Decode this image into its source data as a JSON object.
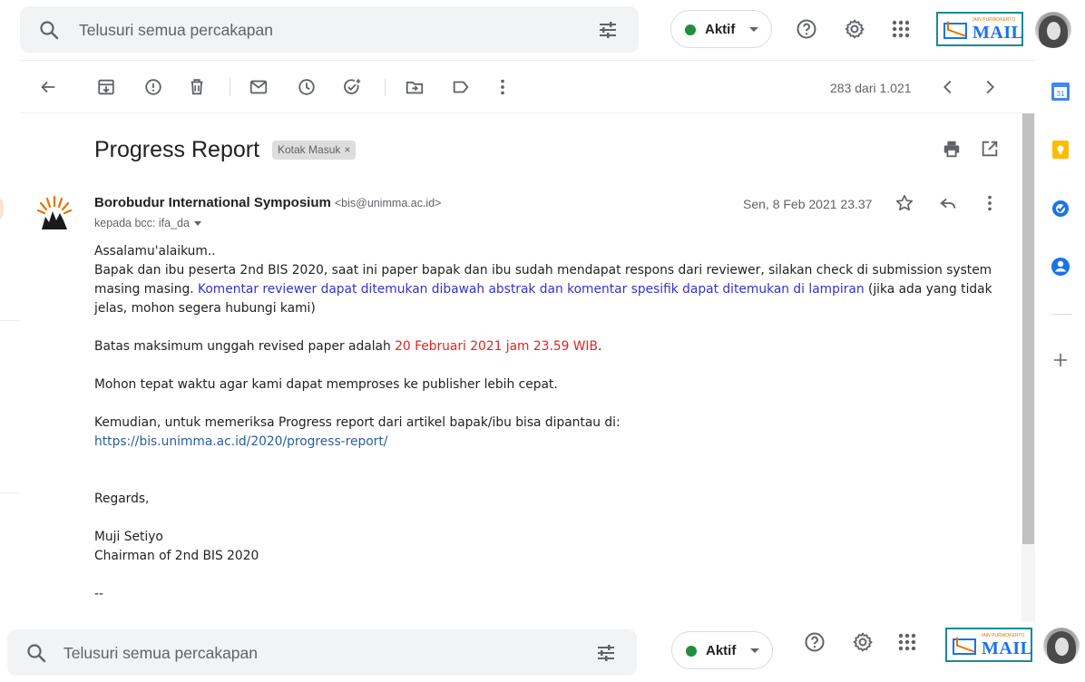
{
  "search": {
    "placeholder": "Telusuri semua percakapan"
  },
  "status": {
    "label": "Aktif",
    "color": "#1e8e3e"
  },
  "brand": {
    "name": "MAIL",
    "tagline": "IAIN PURWOKERTO"
  },
  "icons": {
    "search": "search-icon",
    "tune": "tune-icon",
    "help": "help-icon",
    "settings": "gear-icon",
    "apps": "apps-grid-icon",
    "back": "arrow-back-icon",
    "archive": "archive-icon",
    "spam": "report-spam-icon",
    "delete": "trash-icon",
    "unread": "mail-icon",
    "snooze": "clock-icon",
    "task": "add-task-icon",
    "move": "move-to-icon",
    "label": "label-icon",
    "more": "more-vert-icon",
    "prev": "chevron-left-icon",
    "next": "chevron-right-icon",
    "print": "print-icon",
    "newwin": "open-new-window-icon",
    "star": "star-icon",
    "reply": "reply-icon"
  },
  "toolbar": {
    "counter": "283 dari 1.021"
  },
  "message": {
    "subject": "Progress Report",
    "label": "Kotak Masuk",
    "label_close": "×",
    "sender_name": "Borobudur International Symposium",
    "sender_email": "<bis@unimma.ac.id>",
    "recipient": "kepada bcc: ifa_da",
    "date": "Sen, 8 Feb 2021 23.37",
    "body": {
      "greeting": "Assalamu'alaikum..",
      "p1_a": "Bapak dan ibu peserta 2nd BIS 2020, saat ini paper bapak dan ibu sudah mendapat respons dari reviewer, silakan check di submission system masing masing. ",
      "p1_link": "Komentar reviewer dapat ditemukan dibawah abstrak dan komentar spesifik dapat ditemukan di lampiran",
      "p1_b": " (jika ada yang tidak jelas, mohon segera hubungi kami)",
      "p2_a": "Batas maksimum unggah revised paper adalah ",
      "p2_deadline": "20 Februari 2021 jam 23.59 WIB",
      "p2_b": ".",
      "p3": "Mohon tepat waktu agar kami dapat memproses ke publisher lebih cepat.",
      "p4": "Kemudian, untuk memeriksa Progress report dari artikel bapak/ibu bisa dipantau di:",
      "p4_url": "https://bis.unimma.ac.id/2020/progress-report/",
      "regards": "Regards,",
      "signer": "Muji Setiyo",
      "signer_title": "Chairman of 2nd BIS 2020",
      "sig_sep": "--"
    }
  },
  "colors": {
    "blue_text": "#3333cc",
    "red_text": "#e62222",
    "link": "#2a5e9c"
  }
}
